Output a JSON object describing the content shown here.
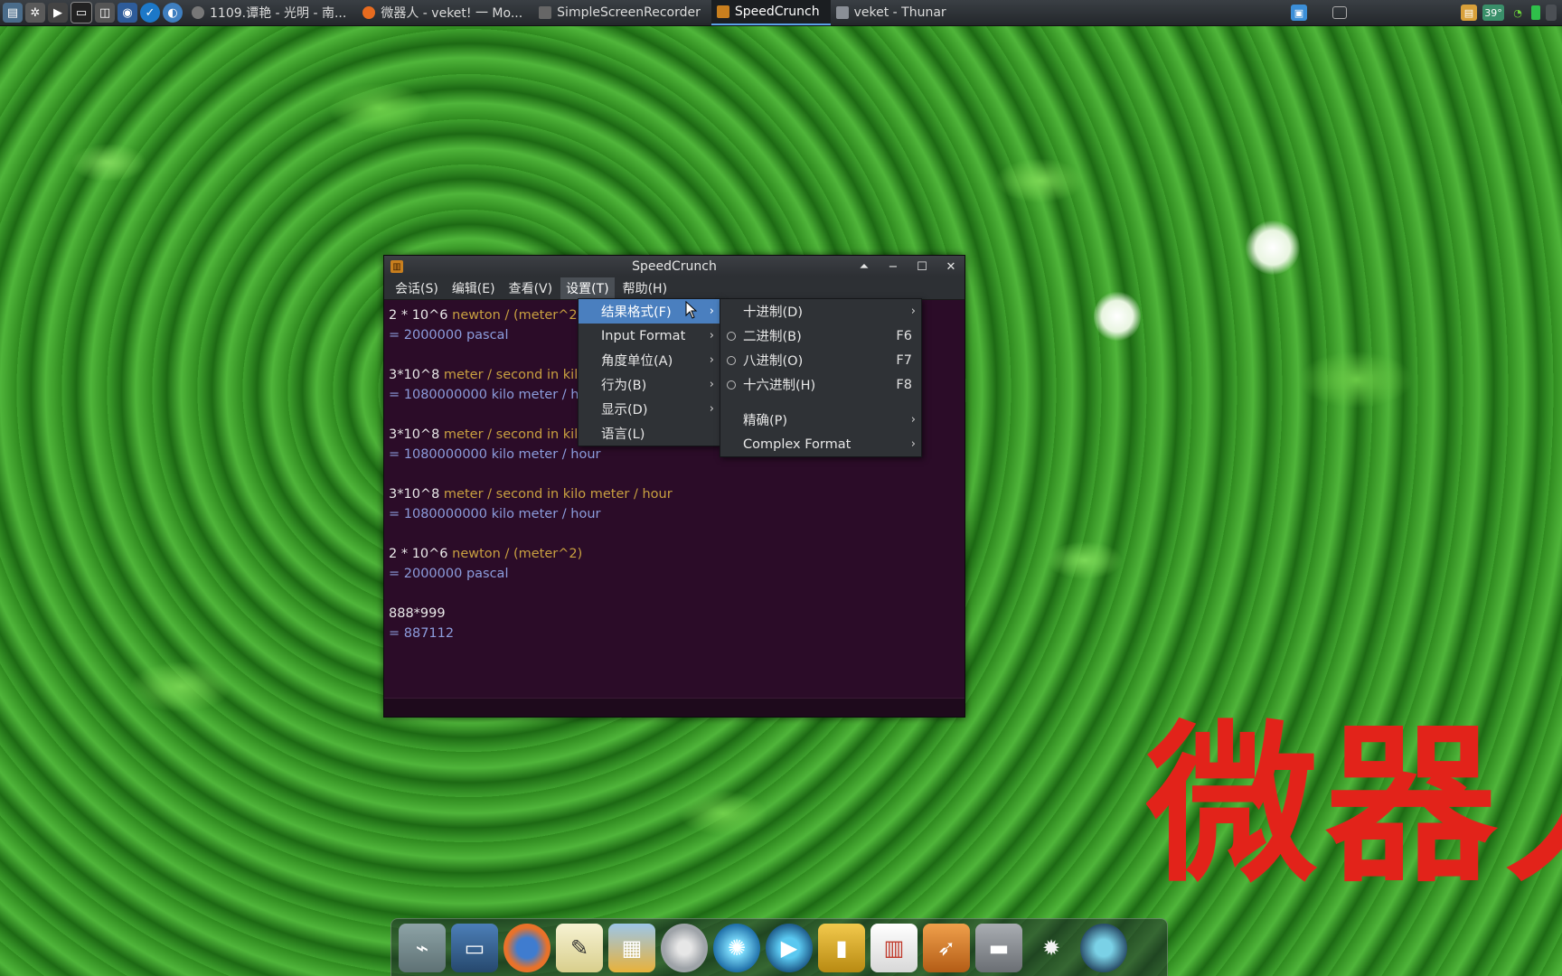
{
  "colors": {
    "menu_highlight": "#4a7fbf",
    "result_text": "#8c9ddd",
    "unit_text": "#c9a040",
    "big_text": "#e2231a",
    "display_bg": "#2b0c28"
  },
  "taskbar": {
    "launchers": [
      "app-menu-icon",
      "settings-icon",
      "play-icon",
      "terminal-icon",
      "screenshot-icon",
      "camera-icon",
      "clock-icon",
      "globe-icon"
    ],
    "tasks": [
      {
        "label": "1109.谭艳 - 光明 - 南...",
        "icon": "music-player-icon",
        "active": false
      },
      {
        "label": "微器人 - veket! 一 Mo...",
        "icon": "firefox-icon",
        "active": false
      },
      {
        "label": "SimpleScreenRecorder",
        "icon": "recorder-icon",
        "active": false
      },
      {
        "label": "SpeedCrunch",
        "icon": "speedcrunch-icon",
        "active": true
      },
      {
        "label": "veket - Thunar",
        "icon": "folder-icon",
        "active": false
      }
    ],
    "tray": {
      "temperature": "39°"
    }
  },
  "window": {
    "title": "SpeedCrunch",
    "menus": [
      "会话(S)",
      "编辑(E)",
      "查看(V)",
      "设置(T)",
      "帮助(H)"
    ],
    "history": [
      {
        "expr": "2 * 10^6",
        "unit": "newton / (meter^2)",
        "result": "= 2000000 pascal"
      },
      {
        "expr": "3*10^8",
        "unit": "meter / second in kilo meter / hour",
        "result": "= 1080000000 kilo meter / hour"
      },
      {
        "expr": "3*10^8",
        "unit": "meter / second in kilo meter / hour",
        "result": "= 1080000000 kilo meter / hour"
      },
      {
        "expr": "3*10^8",
        "unit": "meter / second in kilo meter / hour",
        "result": "= 1080000000 kilo meter / hour"
      },
      {
        "expr": "2 * 10^6",
        "unit": "newton / (meter^2)",
        "result": "= 2000000 pascal"
      },
      {
        "expr": "888*999",
        "unit": "",
        "result": "= 887112"
      }
    ]
  },
  "settings_menu": {
    "items": [
      {
        "label": "结果格式(F)",
        "submenu": true,
        "highlighted": true
      },
      {
        "label": "Input Format",
        "submenu": true
      },
      {
        "label": "角度单位(A)",
        "submenu": true
      },
      {
        "label": "行为(B)",
        "submenu": true
      },
      {
        "label": "显示(D)",
        "submenu": true
      },
      {
        "label": "语言(L)",
        "submenu": false
      }
    ]
  },
  "result_format_menu": {
    "items": [
      {
        "label": "十进制(D)",
        "submenu": true,
        "radio": false,
        "shortcut": ""
      },
      {
        "label": "二进制(B)",
        "submenu": false,
        "radio": true,
        "shortcut": "F6"
      },
      {
        "label": "八进制(O)",
        "submenu": false,
        "radio": true,
        "shortcut": "F7"
      },
      {
        "label": "十六进制(H)",
        "submenu": false,
        "radio": true,
        "shortcut": "F8"
      },
      {
        "label": "精确(P)",
        "submenu": true,
        "radio": false,
        "shortcut": ""
      },
      {
        "label": "Complex Format",
        "submenu": true,
        "radio": false,
        "shortcut": ""
      }
    ]
  },
  "overlay_text": "微器人",
  "dock": {
    "items": [
      "installer-icon",
      "computer-icon",
      "firefox-icon",
      "text-editor-icon",
      "image-viewer-icon",
      "disc-burner-icon",
      "network-icon",
      "media-player-icon",
      "files-icon",
      "office-chart-icon",
      "rocket-icon",
      "printer-icon",
      "brightness-icon",
      "globe-icon"
    ]
  }
}
